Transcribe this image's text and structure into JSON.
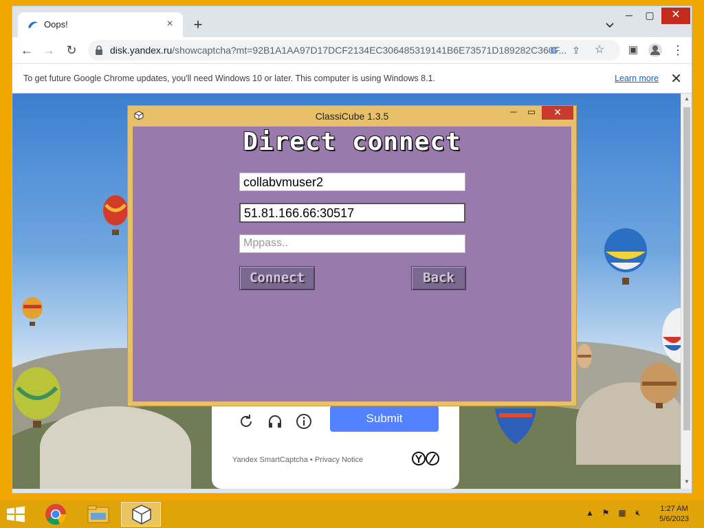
{
  "browser": {
    "tab_title": "Oops!",
    "tab_close": "×",
    "new_tab": "+",
    "url_host": "disk.yandex.ru",
    "url_path": "/showcaptcha?mt=92B1A1AA97D17DCF2134EC306485319141B6E73571D189282C360F...",
    "infobar_text": "To get future Google Chrome updates, you'll need Windows 10 or later. This computer is using Windows 8.1.",
    "infobar_link": "Learn more",
    "infobar_close": "✕"
  },
  "captcha": {
    "submit_label": "Submit",
    "footer_text": "Yandex SmartCaptcha • Privacy Notice"
  },
  "classicube": {
    "window_title": "ClassiCube 1.3.5",
    "heading": "Direct connect",
    "username_value": "collabvmuser2",
    "address_value": "51.81.166.66:30517",
    "mppass_placeholder": "Mppass..",
    "connect_label": "Connect",
    "back_label": "Back"
  },
  "taskbar": {
    "time": "1:27 AM",
    "date": "5/6/2023"
  },
  "icons": [
    "windows-logo-icon",
    "chrome-icon",
    "file-explorer-icon",
    "classicube-icon",
    "reload-icon",
    "headphones-icon",
    "info-icon",
    "lock-icon",
    "profile-icon"
  ]
}
